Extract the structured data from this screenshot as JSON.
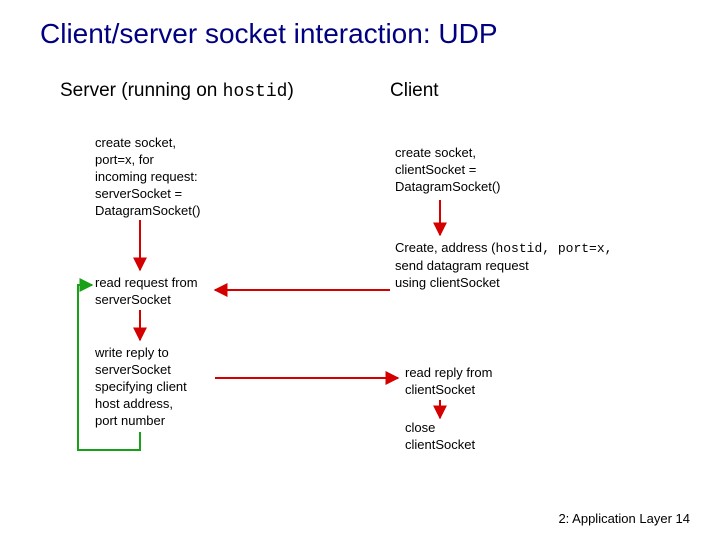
{
  "title": "Client/server socket interaction: UDP",
  "server_heading": {
    "prefix": "Server ",
    "paren_open": "(running on ",
    "host": "hostid",
    "paren_close": ")"
  },
  "client_heading": "Client",
  "server_steps": {
    "create": "create socket,\nport=x, for\nincoming request:\nserverSocket =\nDatagramSocket()",
    "read": "read request from\nserverSocket",
    "write": "write reply to\nserverSocket\nspecifying client\nhost address,\nport number"
  },
  "client_steps": {
    "create": "create socket,\nclientSocket =\nDatagramSocket()",
    "send_pre": "Create, address (",
    "send_code": "hostid, port=x,",
    "send_post": "send datagram request\nusing clientSocket",
    "read": "read reply from\nclientSocket",
    "close": "close\nclientSocket"
  },
  "footer": {
    "text": "2: Application Layer",
    "page": "14"
  }
}
